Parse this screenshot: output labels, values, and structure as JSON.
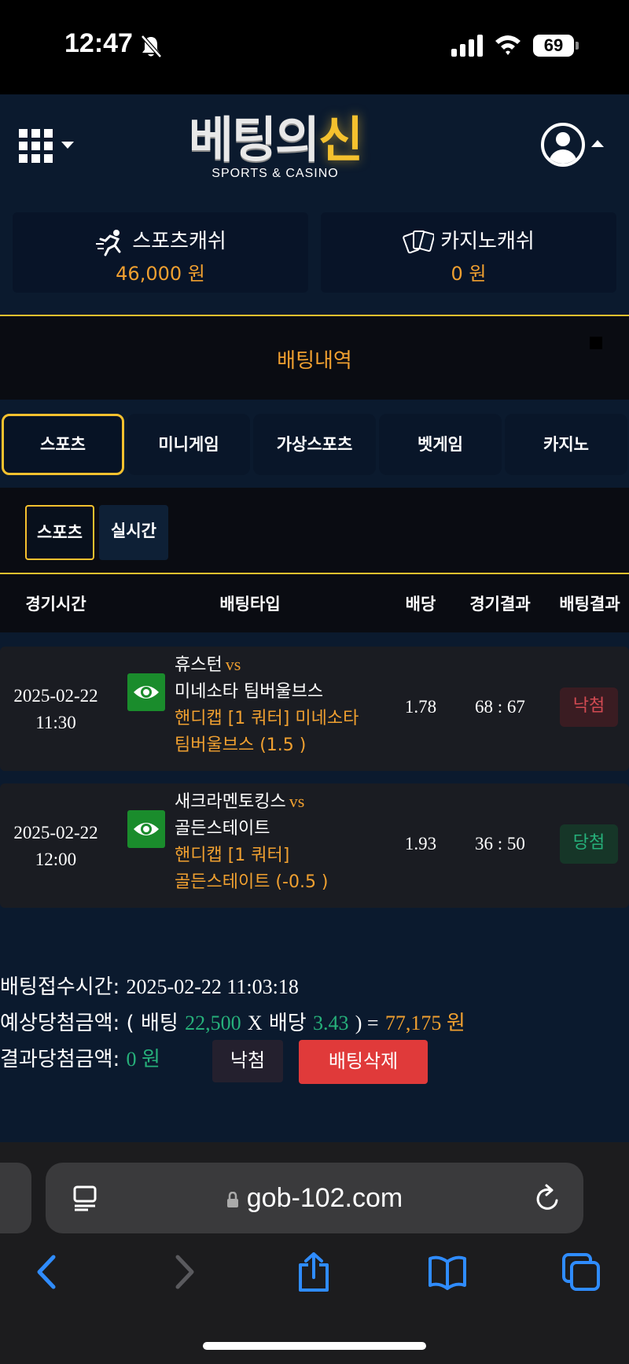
{
  "status_bar": {
    "time": "12:47",
    "battery": "69",
    "icons": [
      "bell-slash-icon",
      "signal-icon",
      "wifi-icon",
      "battery-icon"
    ]
  },
  "header": {
    "logo_main_a": "베팅의",
    "logo_main_b": "신",
    "logo_sub": "SPORTS & CASINO",
    "menu_icon": "grid-menu-icon",
    "user_icon": "user-account-icon"
  },
  "cash": {
    "sports_label": "스포츠캐쉬",
    "sports_value": "46,000 원",
    "casino_label": "카지노캐쉬",
    "casino_value": "0 원"
  },
  "section_title": "배팅내역",
  "tabs": [
    {
      "label": "스포츠",
      "active": true
    },
    {
      "label": "미니게임",
      "active": false
    },
    {
      "label": "가상스포츠",
      "active": false
    },
    {
      "label": "벳게임",
      "active": false
    },
    {
      "label": "카지노",
      "active": false
    }
  ],
  "subtabs": [
    {
      "label": "스포츠",
      "active": true
    },
    {
      "label": "실시간",
      "active": false
    }
  ],
  "table": {
    "headers": [
      "경기시간",
      "배팅타입",
      "배당",
      "경기결과",
      "배팅결과"
    ],
    "rows": [
      {
        "date": "2025-02-22",
        "time": "11:30",
        "home": "휴스턴",
        "vs": "vs",
        "away": "미네소타 팀버울브스",
        "pick_line1": "핸디캡 [1 쿼터] 미네소타",
        "pick_line2": "팀버울브스 (1.5 )",
        "odds": "1.78",
        "score": "68 : 67",
        "result": "낙첨"
      },
      {
        "date": "2025-02-22",
        "time": "12:00",
        "home": "새크라멘토킹스",
        "vs": "vs",
        "away": "골든스테이트",
        "pick_line1": "핸디캡 [1 쿼터]",
        "pick_line2": "골든스테이트 (-0.5 )",
        "odds": "1.93",
        "score": "36 : 50",
        "result": "당첨"
      }
    ]
  },
  "summary": {
    "accept_label": "배팅접수시간:",
    "accept_value": "2025-02-22 11:03:18",
    "expected_label": "예상당첨금액:",
    "expected_open": "( 배팅",
    "stake": "22,500",
    "x": "X",
    "odds_label": "배당",
    "total_odds": "3.43",
    "expected_close": ") =",
    "expected_amount": "77,175 원",
    "result_label": "결과당첨금액:",
    "result_amount": "0 원",
    "lose_button": "낙첨",
    "delete_button": "배팅삭제"
  },
  "browser": {
    "url": "gob-102.com"
  },
  "colors": {
    "accent_gold": "#f5c12e",
    "orange_text": "#f0a030",
    "win_green": "#26b07a",
    "lose_red": "#d24a52",
    "delete_red": "#e03a3a",
    "bg_navy": "#0b1a2e"
  }
}
